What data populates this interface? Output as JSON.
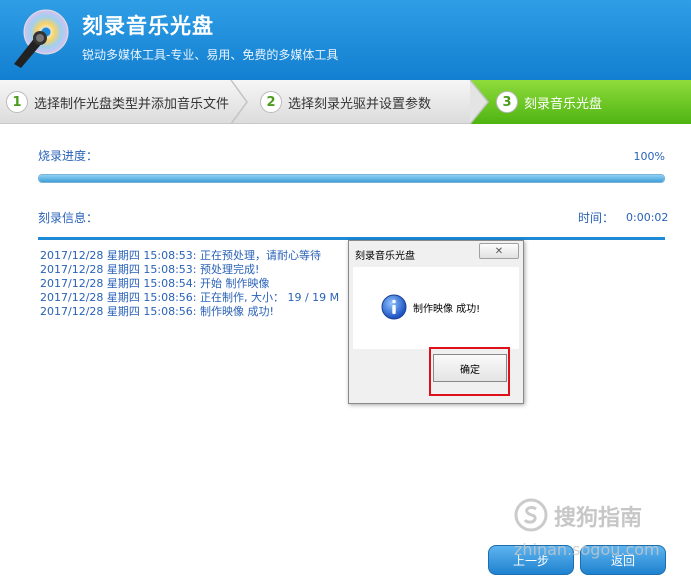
{
  "header": {
    "title": "刻录音乐光盘",
    "subtitle": "锐动多媒体工具-专业、易用、免费的多媒体工具"
  },
  "steps": [
    {
      "num": "1",
      "label": "选择制作光盘类型并添加音乐文件"
    },
    {
      "num": "2",
      "label": "选择刻录光驱并设置参数"
    },
    {
      "num": "3",
      "label": "刻录音乐光盘"
    }
  ],
  "progress": {
    "label": "烧录进度：",
    "percent_text": "100%",
    "value": 100
  },
  "info": {
    "label": "刻录信息：",
    "time_label": "时间：",
    "time_value": "0:00:02"
  },
  "log": [
    "2017/12/28 星期四 15:08:53: 正在预处理，请耐心等待",
    "2017/12/28 星期四 15:08:53: 预处理完成!",
    "2017/12/28 星期四 15:08:54: 开始 制作映像",
    "2017/12/28 星期四 15:08:56: 正在制作, 大小： 19 / 19 M",
    "2017/12/28 星期四 15:08:56: 制作映像 成功!"
  ],
  "dialog": {
    "title": "刻录音乐光盘",
    "close_glyph": "✕",
    "message": "制作映像 成功!",
    "ok_label": "确定"
  },
  "buttons": {
    "prev": "上一步",
    "back": "返回"
  },
  "watermark": {
    "text": "搜狗指南",
    "domain": "zhinan.sogou.com"
  },
  "colors": {
    "header_blue": "#1b8ad8",
    "active_step_green": "#5cbf1a",
    "text_blue": "#2a62b8",
    "highlight_red": "#e0101a"
  }
}
